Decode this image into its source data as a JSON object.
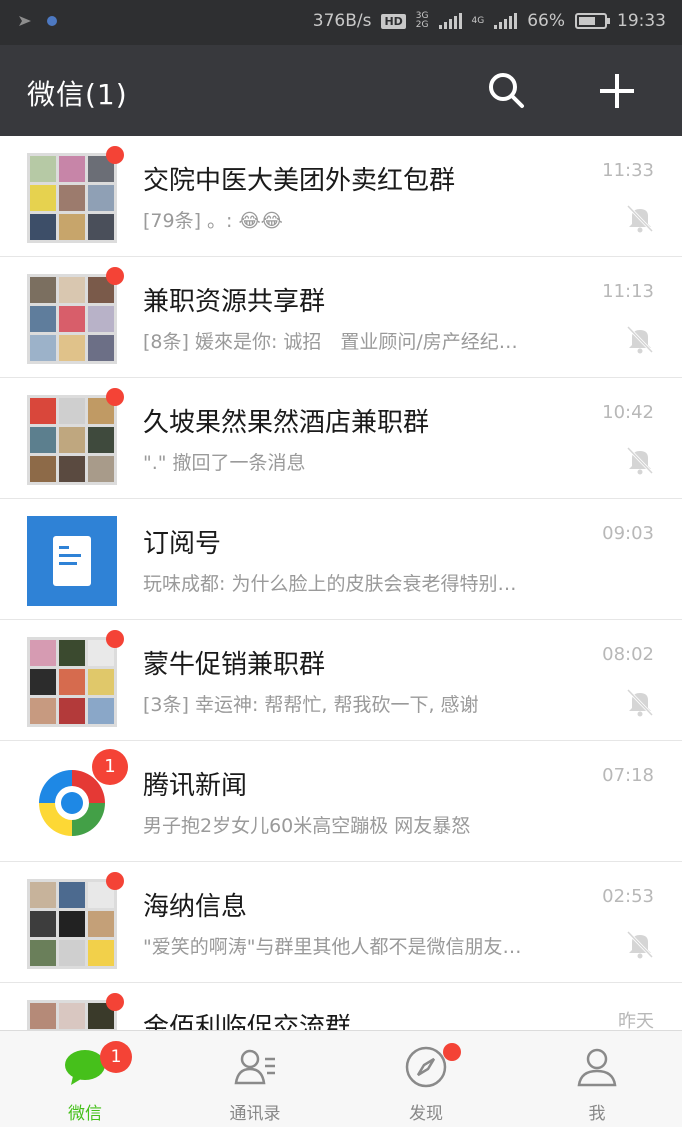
{
  "status_bar": {
    "net_speed": "376B/s",
    "hd": "HD",
    "sim1_label_top": "3G",
    "sim1_label_bottom": "2G",
    "sim2_label": "4G",
    "battery": "66%",
    "battery_level": 0.66,
    "time": "19:33"
  },
  "header": {
    "title": "微信(1)",
    "search_icon": "search-icon",
    "add_icon": "plus-icon"
  },
  "chats": [
    {
      "name": "交院中医大美团外卖红包群",
      "message": "[79条] 。: 😂😂",
      "time": "11:33",
      "muted": true,
      "unread_dot": true
    },
    {
      "name": "兼职资源共享群",
      "message": "[8条] 媛來是你: 诚招　置业顾问/房产经纪…",
      "time": "11:13",
      "muted": true,
      "unread_dot": true
    },
    {
      "name": "久坡果然果然酒店兼职群",
      "message": "\".\" 撤回了一条消息",
      "time": "10:42",
      "muted": true,
      "unread_dot": true
    },
    {
      "name": "订阅号",
      "message": "玩味成都: 为什么脸上的皮肤会衰老得特别…",
      "time": "09:03",
      "muted": false,
      "unread_dot": false
    },
    {
      "name": "蒙牛促销兼职群",
      "message": "[3条] 幸运神: 帮帮忙, 帮我砍一下, 感谢",
      "time": "08:02",
      "muted": true,
      "unread_dot": true
    },
    {
      "name": "腾讯新闻",
      "message": "男子抱2岁女儿60米高空蹦极 网友暴怒",
      "time": "07:18",
      "muted": false,
      "unread_count": "1"
    },
    {
      "name": "海纳信息",
      "message": "\"爱笑的啊涛\"与群里其他人都不是微信朋友…",
      "time": "02:53",
      "muted": true,
      "unread_dot": true
    },
    {
      "name": "金佰利临促交流群",
      "message": "",
      "time": "昨天",
      "muted": false,
      "unread_dot": true
    }
  ],
  "tabs": [
    {
      "label": "微信",
      "icon": "chat-bubble-icon",
      "active": true,
      "badge": "1"
    },
    {
      "label": "通讯录",
      "icon": "contacts-icon",
      "active": false
    },
    {
      "label": "发现",
      "icon": "compass-icon",
      "active": false,
      "dot": true
    },
    {
      "label": "我",
      "icon": "person-icon",
      "active": false
    }
  ],
  "colors": {
    "accent_green": "#46c01b",
    "badge_red": "#f44336",
    "header_bg": "#38393d",
    "status_bg": "#2e2f31"
  }
}
